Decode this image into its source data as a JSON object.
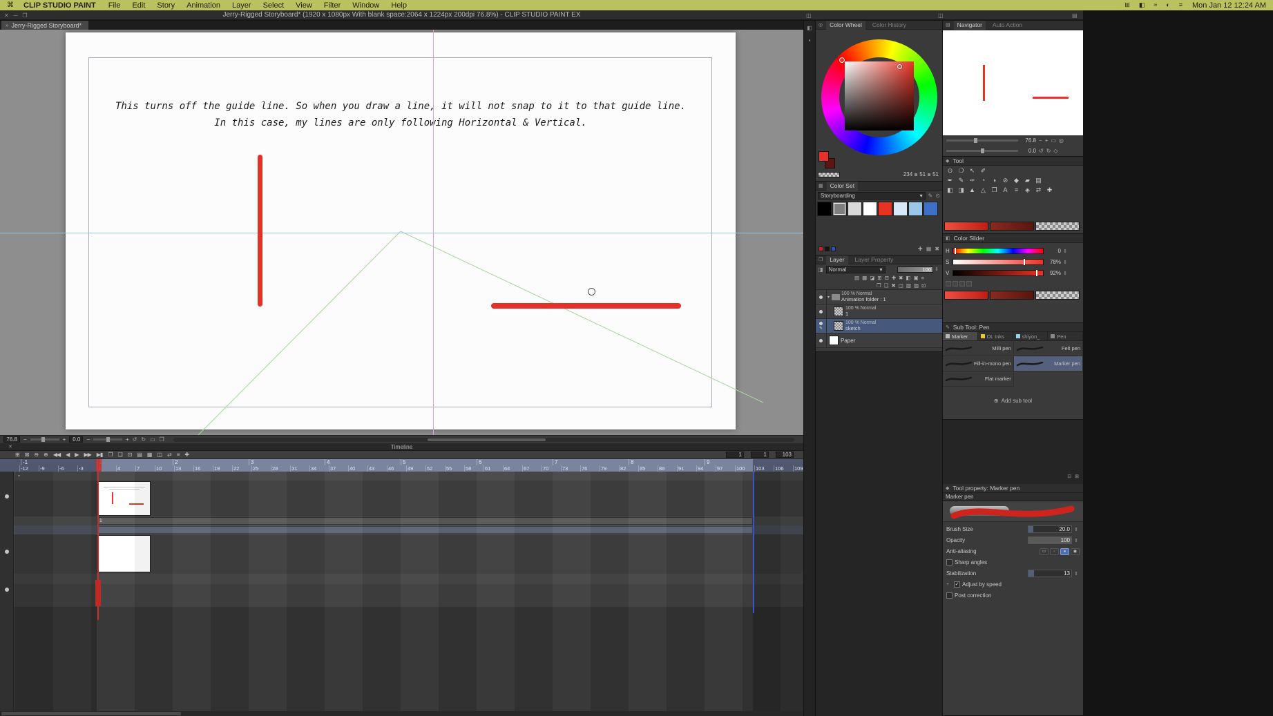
{
  "colors": {
    "accent_red": "#e6302a",
    "guide_horizontal": "#9cc3e8",
    "guide_vertical": "#d8a3da",
    "guide_diagonal": "#a9d4a0",
    "selection_blue": "#46597c",
    "menubar_olive": "#bcc15f"
  },
  "icons": {
    "caret_down": "▾",
    "stepper": "⇕",
    "check": "✓",
    "minus": "−",
    "plus": "+",
    "expand": "▾"
  },
  "menu_bar": {
    "apple_icon": "⌘",
    "app_name": "CLIP STUDIO PAINT",
    "items": [
      "File",
      "Edit",
      "Story",
      "Animation",
      "Layer",
      "Select",
      "View",
      "Filter",
      "Window",
      "Help"
    ],
    "status_icons": [
      "⊞",
      "◧",
      "≈",
      "◐",
      "≡"
    ],
    "clock": "Mon Jan 12 12:24 AM"
  },
  "title_bar": {
    "window_controls": [
      "✕",
      "─",
      "❐"
    ],
    "dock_icons": [
      "◫",
      "◫",
      "▤"
    ],
    "title": "Jerry-Rigged Storyboard* (1920 x 1080px With blank space:2064 x 1224px 200dpi 76.8%)  - CLIP STUDIO PAINT EX"
  },
  "tab_bar": {
    "chevron": "»",
    "document_tab": "Jerry-Rigged Storyboard*"
  },
  "dock_strip": {
    "icons": [
      "◧",
      "▪"
    ]
  },
  "canvas": {
    "caption_line1": "This turns off the guide line. So when you draw a line, it will not snap to it to that guide line.",
    "caption_line2": "In this case, my lines are only following Horizontal & Vertical."
  },
  "view_bar": {
    "zoom_value": "76.8",
    "rotate_value": "0.0",
    "icons": [
      "↺",
      "↻",
      "▭",
      "❐"
    ]
  },
  "timeline": {
    "panel_title": "Timeline",
    "close_icon": "✕",
    "toolbar_icons": [
      "⊞",
      "⊠",
      "⊖",
      "⊕",
      "◀◀",
      "◀",
      "▶",
      "▶▶",
      "▶▮",
      "❐",
      "❑",
      "⊡",
      "▤",
      "▦",
      "◫",
      "⇄",
      "≡",
      "✚"
    ],
    "start_value": "1",
    "current_value": "1",
    "end_value": "103",
    "seconds": [
      "-1",
      "1",
      "2",
      "3",
      "4",
      "5",
      "6",
      "7",
      "8",
      "9"
    ],
    "frames": [
      "-12",
      "-9",
      "-6",
      "-3",
      "1",
      "4",
      "7",
      "10",
      "13",
      "16",
      "19",
      "22",
      "25",
      "28",
      "31",
      "34",
      "37",
      "40",
      "43",
      "46",
      "49",
      "52",
      "55",
      "58",
      "61",
      "64",
      "67",
      "70",
      "73",
      "76",
      "79",
      "82",
      "85",
      "88",
      "91",
      "94",
      "97",
      "100",
      "103",
      "106",
      "109"
    ],
    "clip_label": "1"
  },
  "color_wheel": {
    "tab_active": "Color Wheel",
    "tab_inactive": "Color History",
    "rgb": [
      "234",
      "51",
      "51"
    ]
  },
  "color_set": {
    "tab": "Color Set",
    "preset": "Storyboarding",
    "preset_icons": [
      "✎",
      "⊙"
    ],
    "swatches": [
      {
        "color": "#000000"
      },
      {
        "color": "#7f7f7f",
        "selected": true
      },
      {
        "color": "#d9d9d9"
      },
      {
        "color": "#ffffff"
      },
      {
        "color": "#e83323"
      },
      {
        "color": "#d8e9f8"
      },
      {
        "color": "#9cc6ea"
      },
      {
        "color": "#3f70c8"
      }
    ],
    "mini_swatches": [
      "#cc2222",
      "#141414",
      "#2a52c8"
    ],
    "footer_icons": [
      "✚",
      "▦",
      "✖"
    ]
  },
  "layer_panel": {
    "tab_active": "Layer",
    "tab_inactive": "Layer Property",
    "blend_mode": "Normal",
    "opacity_value": "100",
    "toolbar_row1": [
      "▤",
      "▦",
      "◪",
      "⊞",
      "⊟",
      "✚",
      "✖",
      "◧",
      "▣",
      "≡"
    ],
    "toolbar_row2": [
      "❐",
      "❑",
      "✖",
      "◫",
      "▧",
      "▨",
      "⊡"
    ],
    "layers": [
      {
        "info": "100 % Normal",
        "name": "Animation folder : 1"
      },
      {
        "info": "100 % Normal",
        "name": "1"
      },
      {
        "info": "100 % Normal",
        "name": "sketch",
        "selected": true
      },
      {
        "info": "",
        "name": "Paper"
      }
    ]
  },
  "navigator": {
    "tab_active": "Navigator",
    "tab_inactive": "Auto Action",
    "zoom_value": "76.8",
    "rotate_value": "0.0",
    "zoom_icons": [
      "−",
      "+",
      "▭",
      "◎"
    ],
    "rotate_icons": [
      "↺",
      "↻",
      "◇"
    ]
  },
  "tool_panel": {
    "title": "Tool",
    "row1": [
      "⊙",
      "❍",
      "↖",
      "✐"
    ],
    "row2": [
      "✒",
      "✎",
      "✑",
      "◔",
      "◑",
      "⊘",
      "◆",
      "▰",
      "▤"
    ],
    "row3": [
      "◧",
      "◨",
      "▲",
      "△",
      "❐",
      "A",
      "≡",
      "◈",
      "⇄",
      "✚"
    ]
  },
  "color_slider": {
    "title": "Color Slider",
    "sliders": [
      {
        "label": "H",
        "value": "0"
      },
      {
        "label": "S",
        "value": "78%"
      },
      {
        "label": "V",
        "value": "92%"
      }
    ]
  },
  "sub_tool": {
    "title": "Sub Tool: Pen",
    "tabs": [
      {
        "label": "Marker",
        "color": "#b8b8b8",
        "selected": true
      },
      {
        "label": "DL Inks",
        "color": "#e6c832"
      },
      {
        "label": "shiyon_",
        "color": "#9ad0e8"
      },
      {
        "label": "Pen",
        "color": "#888888"
      }
    ],
    "items": [
      {
        "label": "Milli pen"
      },
      {
        "label": "Felt pen"
      },
      {
        "label": "Fill-in-mono pen"
      },
      {
        "label": "Marker pen",
        "selected": true
      },
      {
        "label": "Flat marker"
      }
    ],
    "add_icon": "⊕",
    "add_label": "Add sub tool"
  },
  "tool_property": {
    "title": "Tool property: Marker pen",
    "brush_name": "Marker pen",
    "brush_size_label": "Brush Size",
    "brush_size_value": "20.0",
    "opacity_label": "Opacity",
    "opacity_value": "100",
    "anti_aliasing_label": "Anti-aliasing",
    "sharp_angles_label": "Sharp angles",
    "stabilization_label": "Stabilization",
    "stabilization_value": "13",
    "adjust_by_speed_label": "Adjust by speed",
    "post_correction_label": "Post correction"
  }
}
